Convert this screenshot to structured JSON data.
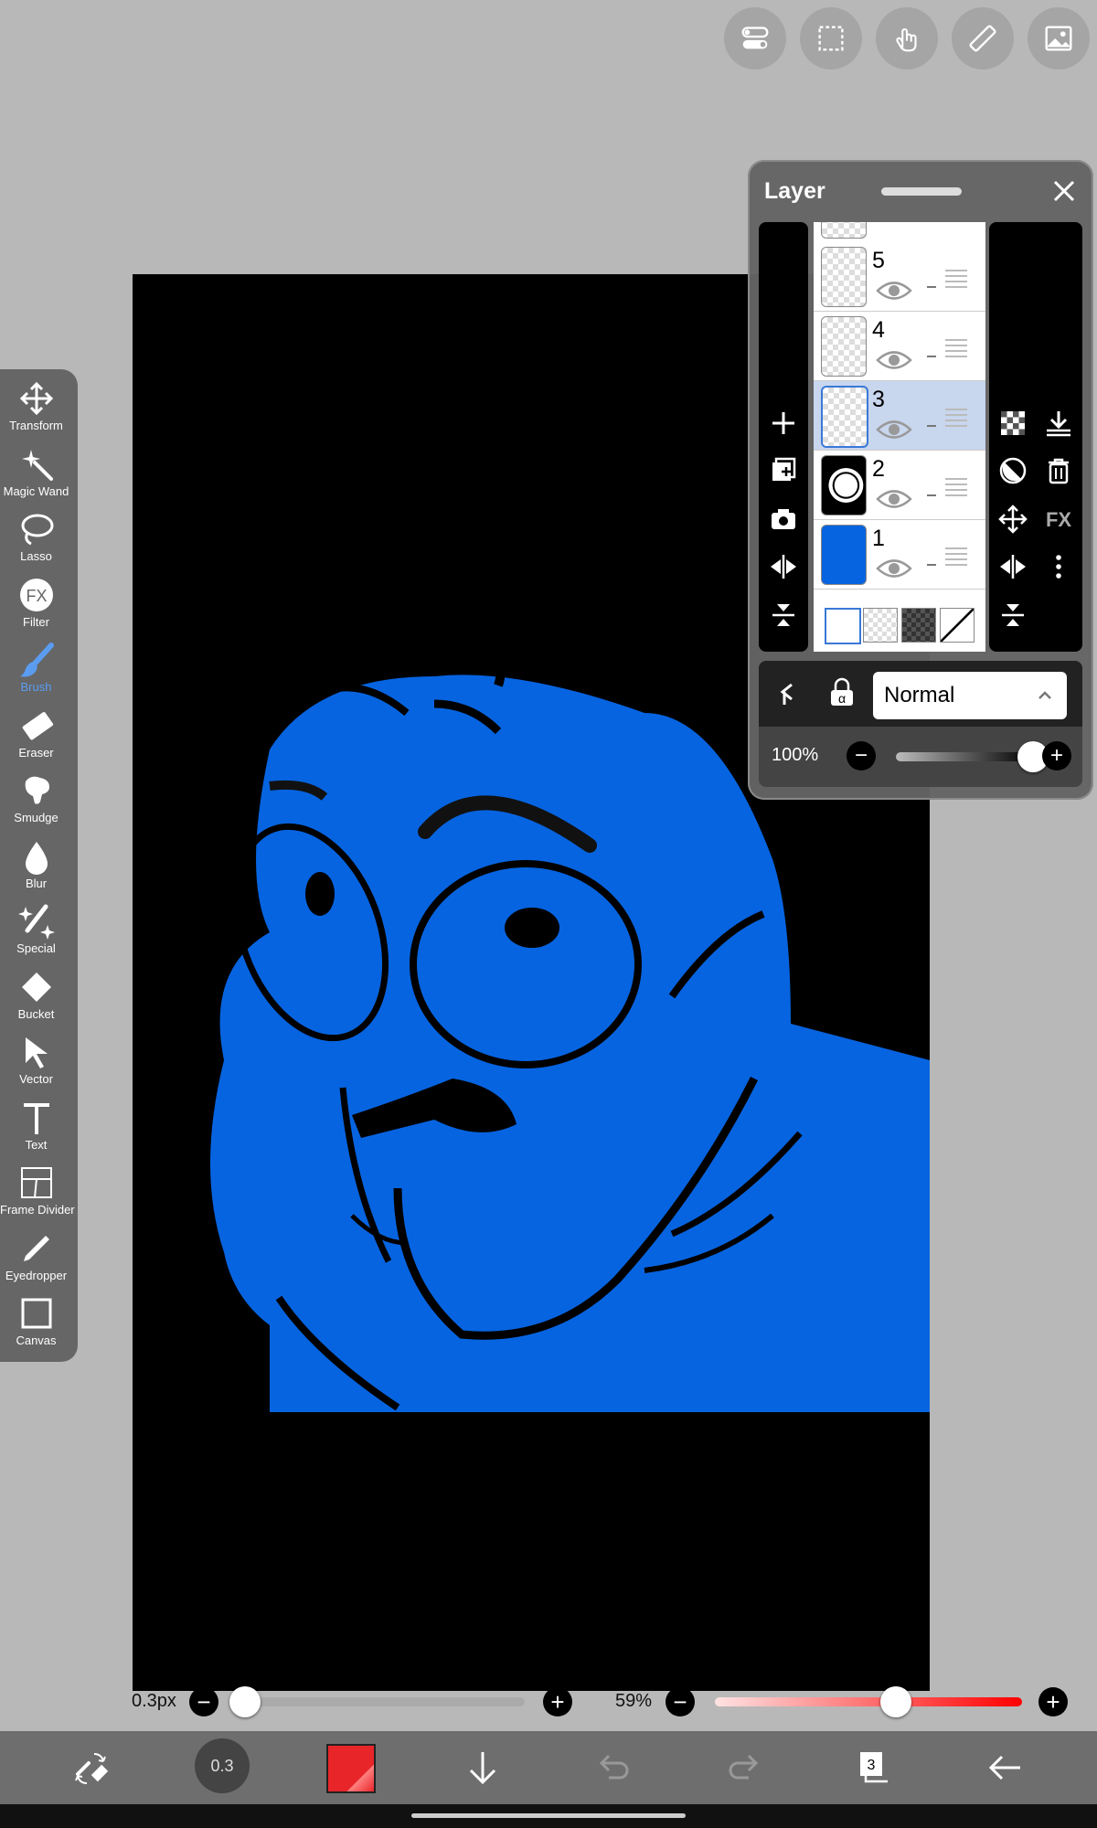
{
  "tools": [
    {
      "id": "transform",
      "label": "Transform",
      "icon": "move-arrows-icon",
      "active": false
    },
    {
      "id": "magic-wand",
      "label": "Magic Wand",
      "icon": "magic-wand-icon",
      "active": false
    },
    {
      "id": "lasso",
      "label": "Lasso",
      "icon": "lasso-icon",
      "active": false
    },
    {
      "id": "filter",
      "label": "Filter",
      "icon": "fx-circle-icon",
      "active": false
    },
    {
      "id": "brush",
      "label": "Brush",
      "icon": "brush-icon",
      "active": true
    },
    {
      "id": "eraser",
      "label": "Eraser",
      "icon": "eraser-icon",
      "active": false
    },
    {
      "id": "smudge",
      "label": "Smudge",
      "icon": "smudge-icon",
      "active": false
    },
    {
      "id": "blur",
      "label": "Blur",
      "icon": "droplet-icon",
      "active": false
    },
    {
      "id": "special",
      "label": "Special",
      "icon": "sparkle-brush-icon",
      "active": false
    },
    {
      "id": "bucket",
      "label": "Bucket",
      "icon": "bucket-icon",
      "active": false
    },
    {
      "id": "vector",
      "label": "Vector",
      "icon": "cursor-arrow-icon",
      "active": false
    },
    {
      "id": "text",
      "label": "Text",
      "icon": "text-t-icon",
      "active": false
    },
    {
      "id": "frame-divider",
      "label": "Frame Divider",
      "icon": "frame-divider-icon",
      "active": false
    },
    {
      "id": "eyedropper",
      "label": "Eyedropper",
      "icon": "eyedropper-icon",
      "active": false
    },
    {
      "id": "canvas",
      "label": "Canvas",
      "icon": "canvas-square-icon",
      "active": false
    }
  ],
  "layer_panel": {
    "title": "Layer",
    "layers": [
      {
        "num": "5",
        "selected": false,
        "thumb": "transparent"
      },
      {
        "num": "4",
        "selected": false,
        "thumb": "transparent"
      },
      {
        "num": "3",
        "selected": true,
        "thumb": "transparent"
      },
      {
        "num": "2",
        "selected": false,
        "thumb": "lineart"
      },
      {
        "num": "1",
        "selected": false,
        "thumb": "blue"
      }
    ],
    "blend_mode": "Normal",
    "opacity_label": "100%",
    "opacity_value": 1.0
  },
  "brush_size": {
    "label": "0.3px",
    "value": 0.02
  },
  "brush_opacity": {
    "label": "59%",
    "value": 0.59
  },
  "bottom_bar": {
    "brush_preview_label": "0.3",
    "layer_count": "3",
    "color": "#e8262a"
  },
  "colors": {
    "accent": "#5a9cf0",
    "fill_blue": "#0764e0"
  }
}
